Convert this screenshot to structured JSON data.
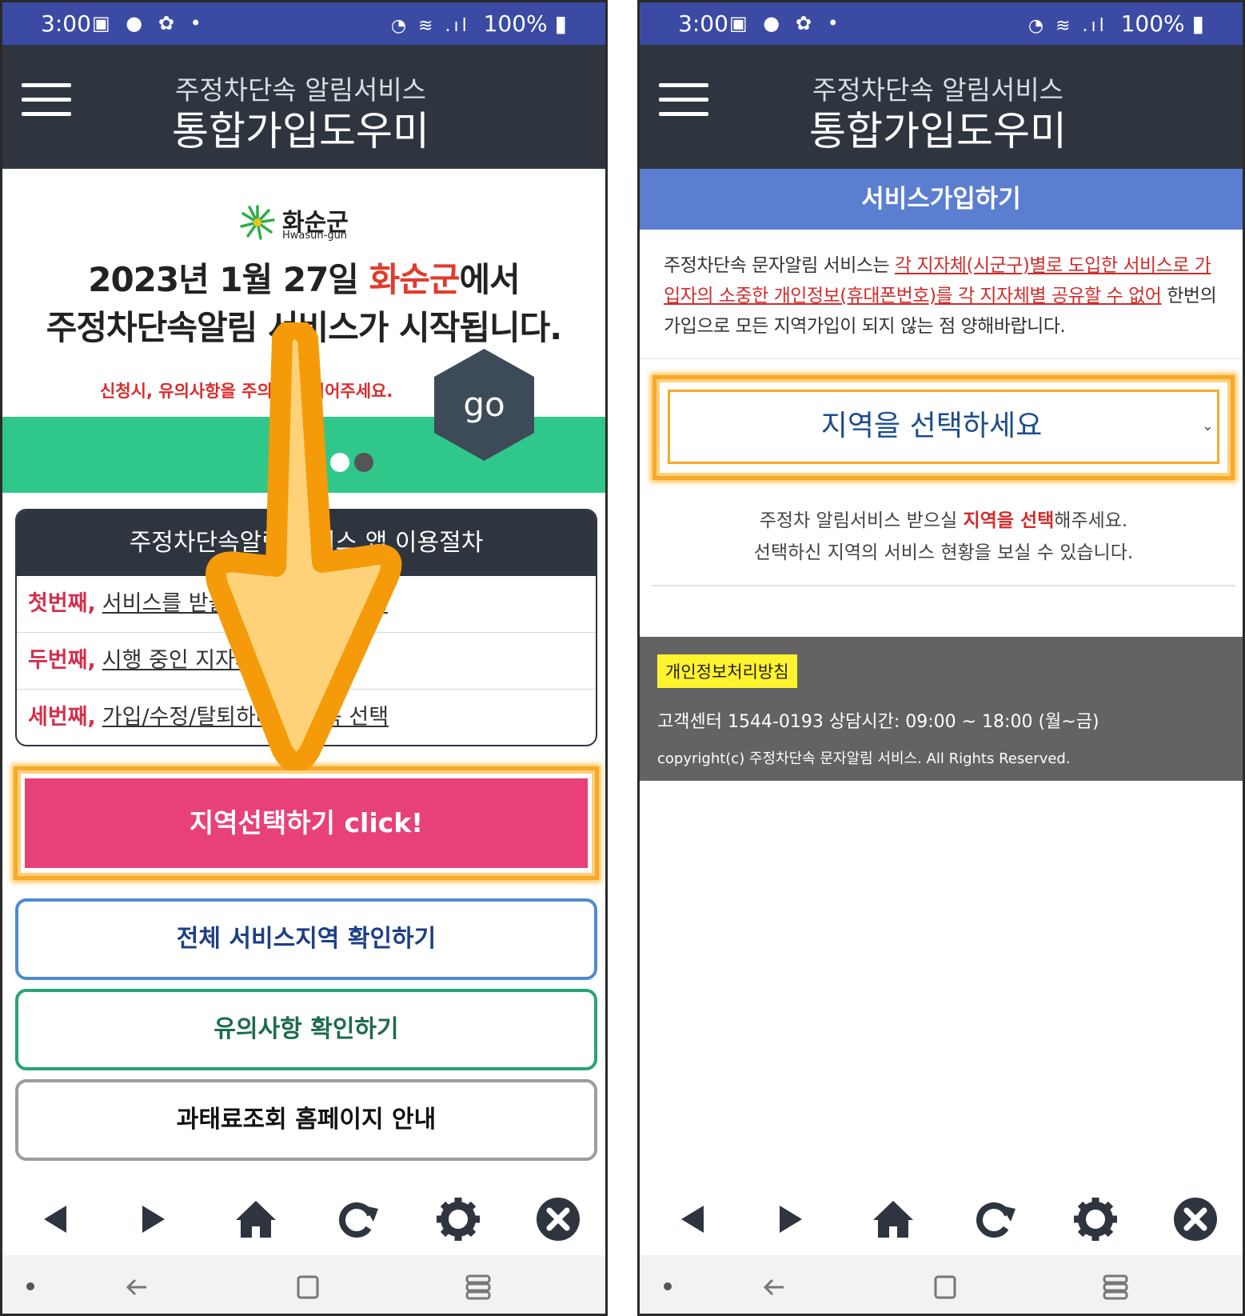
{
  "status": {
    "time": "3:00",
    "battery": "100%",
    "notif_icons": [
      "gallery-icon",
      "kakaotalk-icon",
      "pinwheel-icon",
      "dot-icon"
    ]
  },
  "app": {
    "subtitle": "주정차단속 알림서비스",
    "title": "통합가입도우미"
  },
  "left": {
    "banner": {
      "logo_ko": "화순군",
      "logo_en": "Hwasun-gun",
      "line1_pre": "2023년 1월 27일 ",
      "line1_highlight": "화순군",
      "line1_post": "에서",
      "line2": "주정차단속알림 서비스가 시작됩니다.",
      "note": "신청시, 유의사항을 주의깊게 읽어주세요.",
      "go": "go"
    },
    "procedure": {
      "title": "주정차단속알림 서비스 앱 이용절차",
      "steps": [
        {
          "num": "첫번째,",
          "text": "서비스를 받을 지역 선택하세요."
        },
        {
          "num": "두번째,",
          "text": "시행 중인 지자체 확인"
        },
        {
          "num": "세번째,",
          "text": "가입/수정/탈퇴하려는 항목 선택"
        }
      ]
    },
    "buttons": {
      "region": "지역선택하기 click!",
      "all_regions": "전체 서비스지역 확인하기",
      "caution": "유의사항 확인하기",
      "fine": "과태료조회 홈페이지 안내"
    }
  },
  "right": {
    "header": "서비스가입하기",
    "notice_pre": "주정차단속 문자알림 서비스는 ",
    "notice_red": "각 지자체(시군구)별로 도입한 서비스로 가입자의 소중한 개인정보(휴대폰번호)를 각 지자체별 공유할 수 없어",
    "notice_post": " 한번의 가입으로 모든 지역가입이 되지 않는 점 양해바랍니다.",
    "select_placeholder": "지역을 선택하세요",
    "help_l1_pre": "주정차 알림서비스 받으실 ",
    "help_l1_red": "지역을 선택",
    "help_l1_post": "해주세요.",
    "help_l2": "선택하신 지역의 서비스 현황을 보실 수 있습니다.",
    "footer": {
      "privacy": "개인정보처리방침",
      "contact": "고객센터 1544-0193      상담시간: 09:00 ~ 18:00 (월~금)",
      "copyright": "copyright(c) 주정차단속 문자알림 서비스. All Rights Reserved."
    }
  },
  "colors": {
    "statusbar": "#3b4ba3",
    "appbar": "#2f353f",
    "highlight": "#f7a928",
    "pink": "#e8417a",
    "blue_header": "#5b7ed0",
    "green": "#2fc78a"
  }
}
